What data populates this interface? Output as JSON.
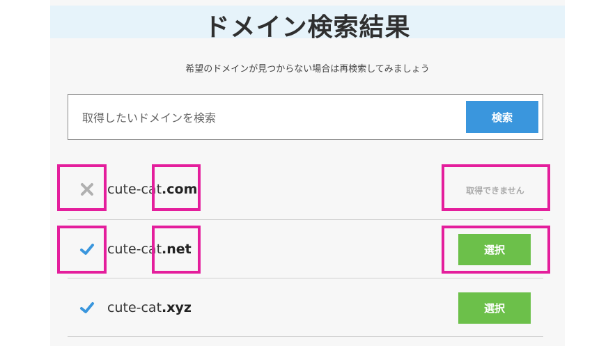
{
  "header": {
    "title": "ドメイン検索結果",
    "subtitle": "希望のドメインが見つからない場合は再検索してみましょう"
  },
  "search": {
    "placeholder": "取得したいドメインを検索",
    "button_label": "検索"
  },
  "results": [
    {
      "name": "cute-cat",
      "tld": ".com",
      "available": false,
      "status_icon": "x-icon",
      "action_label": "取得できません"
    },
    {
      "name": "cute-cat",
      "tld": ".net",
      "available": true,
      "status_icon": "check-icon",
      "action_label": "選択"
    },
    {
      "name": "cute-cat",
      "tld": ".xyz",
      "available": true,
      "status_icon": "check-icon",
      "action_label": "選択"
    }
  ],
  "colors": {
    "search_button": "#3a96dd",
    "select_button": "#6cc04a",
    "highlight_border": "#e41e9c",
    "check": "#3a96dd",
    "cross": "#b0b0b0"
  }
}
